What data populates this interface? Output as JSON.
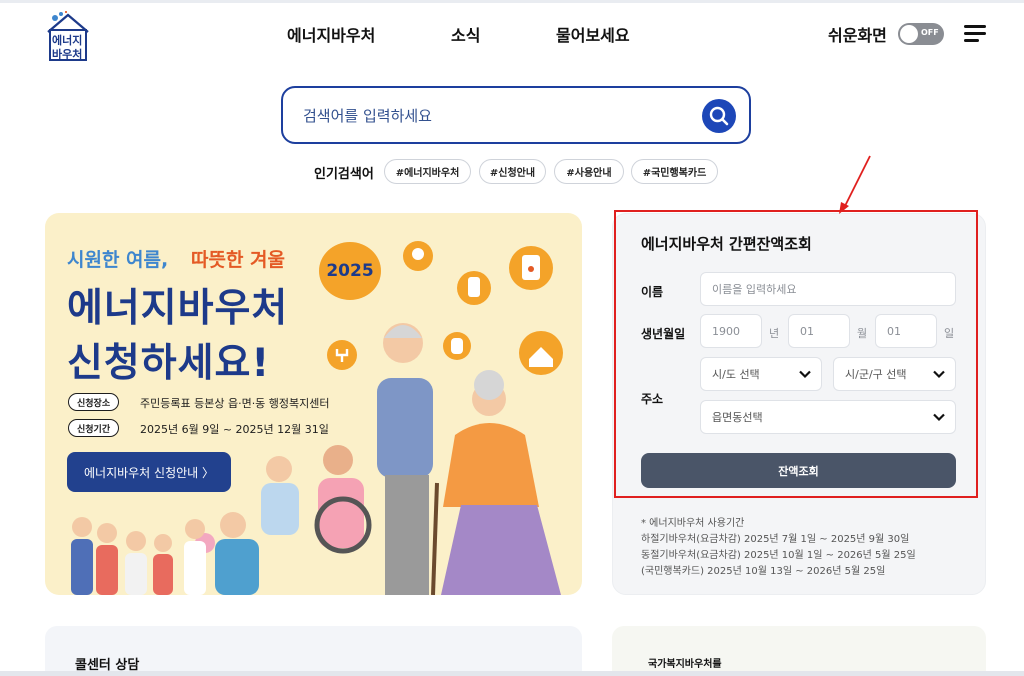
{
  "logo": {
    "line1": "에너지",
    "line2": "바우처"
  },
  "nav": {
    "items": [
      "에너지바우처",
      "소식",
      "물어보세요"
    ]
  },
  "easy_mode": {
    "label": "쉬운화면",
    "toggle_state": "OFF"
  },
  "search": {
    "placeholder": "검색어를 입력하세요",
    "popular_label": "인기검색어",
    "tags": [
      "#에너지바우처",
      "#신청안내",
      "#사용안내",
      "#국민행복카드"
    ]
  },
  "banner": {
    "subtitle_cool": "시원한 여름,",
    "subtitle_warm": "따뜻한 겨울",
    "title_line1": "에너지바우처",
    "title_line2": "신청하세요!",
    "year": "2025",
    "place_label": "신청장소",
    "place_value": "주민등록표 등본상 읍·면·동 행정복지센터",
    "period_label": "신청기간",
    "period_value": "2025년 6월 9일 ~ 2025년 12월 31일",
    "cta": "에너지바우처 신청안내 〉"
  },
  "balance": {
    "title": "에너지바우처 간편잔액조회",
    "name_label": "이름",
    "name_placeholder": "이름을 입력하세요",
    "birth_label": "생년월일",
    "birth_year": "1900",
    "year_unit": "년",
    "birth_month": "01",
    "month_unit": "월",
    "birth_day": "01",
    "day_unit": "일",
    "address_label": "주소",
    "sido_select": "시/도 선택",
    "sigungu_select": "시/군/구 선택",
    "eupmyeondong_select": "읍면동선택",
    "submit": "잔액조회"
  },
  "usage_period": {
    "heading": "* 에너지바우처 사용기간",
    "summer": "하절기바우처(요금차감) 2025년 7월 1일 ~ 2025년 9월 30일",
    "winter": "동절기바우처(요금차감) 2025년 10월 1일 ~ 2026년 5월 25일",
    "card": "(국민행복카드) 2025년 10월 13일 ~ 2026년 5월 25일"
  },
  "bottom": {
    "callcenter": "콜센터 상담",
    "national_voucher": "국가복지바우처를"
  },
  "colors": {
    "brand_navy": "#1d3a8a",
    "search_border": "#1d3f9e",
    "highlight_red": "#e0201f",
    "banner_bg": "#fbf0c9",
    "cool_blue": "#3e86ce",
    "warm_orange": "#e45a25"
  }
}
